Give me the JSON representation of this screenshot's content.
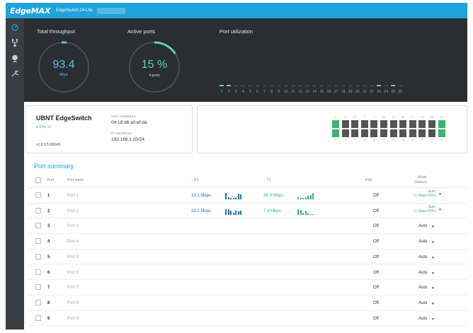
{
  "topbar": {
    "logo": "EdgeMAX",
    "model": "EdgeSwitch 24 Lite"
  },
  "sidebar": {
    "icons": [
      "dashboard-icon",
      "topology-icon",
      "globe-icon",
      "wrench-icon"
    ]
  },
  "dashboard": {
    "throughput": {
      "title": "Total throughput",
      "value": "93.4",
      "unit": "Mbps"
    },
    "ports": {
      "title": "Active ports",
      "value": "15 %",
      "sub": "4 ports"
    },
    "utilization": {
      "title": "Port utilization",
      "port_numbers": [
        "1",
        "2",
        "3",
        "4",
        "5",
        "6",
        "7",
        "8",
        "9",
        "10",
        "11",
        "12",
        "13",
        "14",
        "15",
        "16",
        "17",
        "18",
        "19",
        "20",
        "21",
        "22",
        "23",
        "24",
        "25",
        "26"
      ],
      "active": [
        1,
        2,
        23,
        25
      ]
    }
  },
  "device": {
    "name": "UBNT EdgeSwitch",
    "uptime": "10m 1s",
    "version": "v1.8.0.5106045",
    "mac_label": "MAC ADDRESS",
    "mac": "04:18:d6:a0:ef:da",
    "ip_label": "IP ADDRESS",
    "ip": "192.168.1.20/24"
  },
  "switch_panel": {
    "top_numbers": [
      "1",
      "3",
      "5",
      "7",
      "9",
      "11",
      "13",
      "15",
      "17",
      "19",
      "21",
      "23"
    ],
    "bottom_numbers": [
      "2",
      "4",
      "6",
      "8",
      "10",
      "12",
      "14",
      "16",
      "18",
      "20",
      "22",
      "24"
    ],
    "top_up": [
      1,
      23
    ],
    "bottom_up": [
      2,
      24
    ]
  },
  "summary": {
    "title": "Port summary",
    "headers": {
      "port": "Port",
      "name": "Port name",
      "rx": "↓ RX",
      "tx": "↑ TX",
      "poe": "PoE",
      "mode": "Mode",
      "status": "(Status)"
    },
    "rows": [
      {
        "num": "1",
        "name": "Port 1",
        "rx": "33.1 Mbps",
        "tx": "38.9 Mbps",
        "poe": "Off",
        "mode": "Auto",
        "status": "(1 Gbps FDX)",
        "rx_spark": [
          9,
          3,
          2,
          2,
          3,
          8,
          7
        ],
        "tx_spark": [
          3,
          2,
          2,
          3,
          5,
          6,
          9
        ]
      },
      {
        "num": "2",
        "name": "Port 2",
        "rx": "23.2 Mbps",
        "tx": "7.4 Mbps",
        "poe": "Off",
        "mode": "Auto",
        "status": "(1 Gbps FDX)",
        "rx_spark": [
          8,
          8,
          6,
          3,
          6,
          5,
          6
        ],
        "tx_spark": [
          8,
          7,
          3,
          6,
          3,
          1,
          1
        ]
      },
      {
        "num": "3",
        "name": "Port 3",
        "poe": "Off",
        "mode": "Auto"
      },
      {
        "num": "4",
        "name": "Port 4",
        "poe": "Off",
        "mode": "Auto"
      },
      {
        "num": "5",
        "name": "Port 5",
        "poe": "Off",
        "mode": "Auto"
      },
      {
        "num": "6",
        "name": "Port 6",
        "poe": "Off",
        "mode": "Auto"
      },
      {
        "num": "7",
        "name": "Port 7",
        "poe": "Off",
        "mode": "Auto"
      },
      {
        "num": "8",
        "name": "Port 8",
        "poe": "Off",
        "mode": "Auto"
      },
      {
        "num": "9",
        "name": "Port 9",
        "poe": "Off",
        "mode": "Auto"
      }
    ]
  },
  "colors": {
    "accent": "#1fa3dc",
    "green": "#3cb371",
    "rx": "#1f74b3",
    "dark": "#2a2d31"
  }
}
